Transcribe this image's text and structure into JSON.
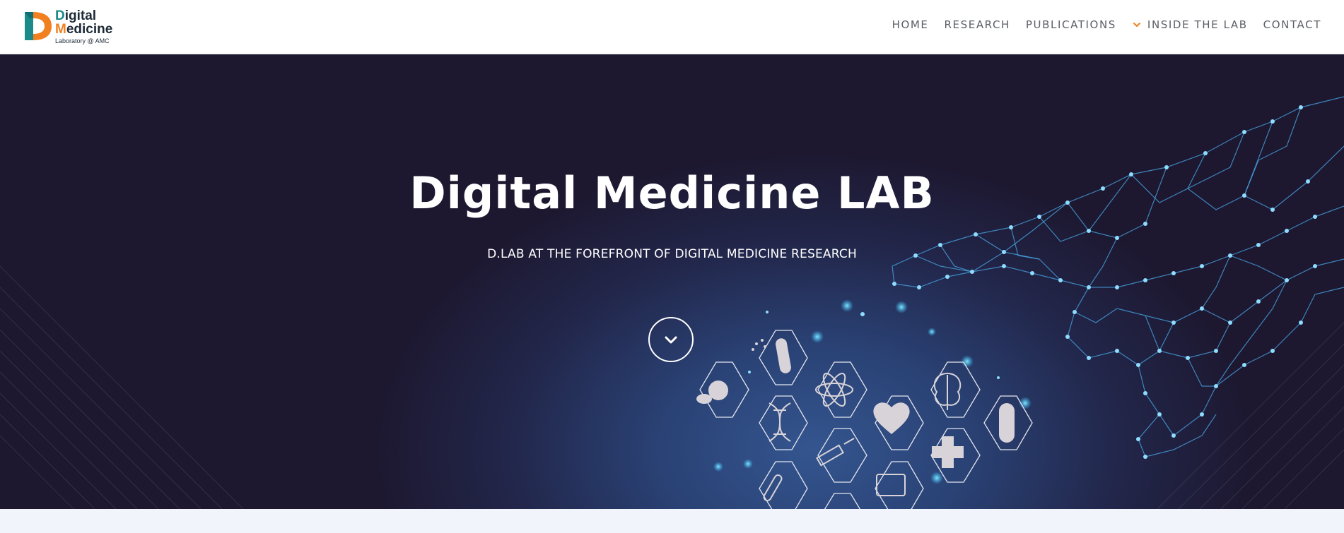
{
  "logo": {
    "line1_first": "D",
    "line1_rest": "igital",
    "line2_first": "M",
    "line2_rest": "edicine",
    "line3": "Laboratory @ AMC",
    "colors": {
      "teal": "#1a8a8a",
      "orange": "#f08020",
      "dark": "#1c2a36"
    }
  },
  "nav": {
    "items": [
      {
        "label": "HOME"
      },
      {
        "label": "RESEARCH"
      },
      {
        "label": "PUBLICATIONS"
      },
      {
        "label": "INSIDE THE LAB",
        "icon": "chevron-down-icon"
      },
      {
        "label": "CONTACT"
      }
    ],
    "accent_color": "#f08020"
  },
  "hero": {
    "title": "Digital Medicine LAB",
    "subtitle": "D.LAB AT THE FOREFRONT OF DIGITAL MEDICINE RESEARCH",
    "scroll_icon": "chevron-down-icon",
    "medical_icons": [
      "pills-icon",
      "pill-bottle-icon",
      "dna-icon",
      "atom-icon",
      "heart-icon",
      "brain-icon",
      "capsule-icon",
      "syringe-icon",
      "plus-icon",
      "thermometer-icon",
      "monitor-icon"
    ],
    "background_colors": [
      "#1d1830",
      "#22264a",
      "#34558f"
    ]
  }
}
